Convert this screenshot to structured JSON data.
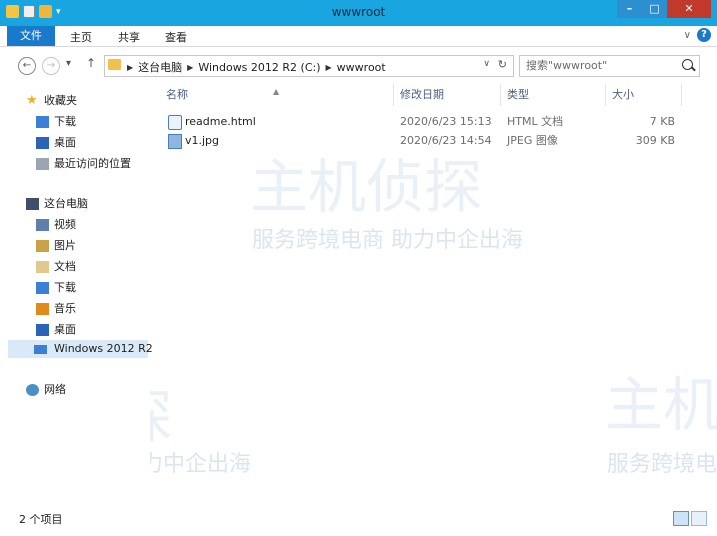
{
  "window": {
    "title": "wwwroot",
    "colors": {
      "titlebar": "#19a6e0",
      "file_tab": "#1979ca",
      "close": "#c0392b"
    }
  },
  "ribbon": {
    "file_tab": "文件",
    "tabs": [
      "主页",
      "共享",
      "查看"
    ]
  },
  "address": {
    "crumbs": [
      "这台电脑",
      "Windows 2012 R2 (C:)",
      "wwwroot"
    ]
  },
  "search": {
    "placeholder": "搜索\"wwwroot\""
  },
  "sidebar": {
    "favorites_label": "收藏夹",
    "favorites": [
      "下载",
      "桌面",
      "最近访问的位置"
    ],
    "pc_label": "这台电脑",
    "pc_items": [
      "视频",
      "图片",
      "文档",
      "下载",
      "音乐",
      "桌面"
    ],
    "drive": "Windows 2012 R2",
    "network": "网络"
  },
  "columns": {
    "name": "名称",
    "date": "修改日期",
    "type": "类型",
    "size": "大小"
  },
  "files": [
    {
      "name": "readme.html",
      "date": "2020/6/23 15:13",
      "type": "HTML 文档",
      "size": "7 KB",
      "icon": "html-file-icon"
    },
    {
      "name": "v1.jpg",
      "date": "2020/6/23 14:54",
      "type": "JPEG 图像",
      "size": "309 KB",
      "icon": "image-file-icon"
    }
  ],
  "status": {
    "count": "2 个项目"
  },
  "watermark": {
    "brand": "主机侦探",
    "slogan": "服务跨境电商 助力中企出海"
  }
}
